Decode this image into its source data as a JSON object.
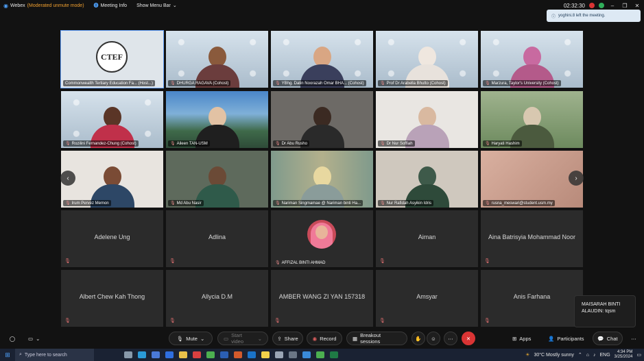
{
  "topbar": {
    "app_name": "Webex",
    "mode": "(Moderated unmute mode)",
    "meeting_info": "Meeting Info",
    "menu_bar": "Show Menu Bar",
    "timer": "02:32:30"
  },
  "toast": {
    "text": "yoghini.8 left the meeting."
  },
  "tiles": {
    "t1": {
      "label": "Commonwealth Tertiary Education Fa... (Host...)",
      "logo_text": "CTEF"
    },
    "t2": {
      "label": "DHURGA RAGAVA (Cohost)"
    },
    "t3": {
      "label": "YBhg. Datin Noorazah Omar BHA... (Cohost)"
    },
    "t4": {
      "label": "Prof Dr Arabella Bhutto (Cohost)"
    },
    "t5": {
      "label": "Marzura, Taylor's University (Cohost)"
    },
    "t6": {
      "label": "Rozilini Fernandez-Chung (Cohost)"
    },
    "t7": {
      "label": "Aileen TAN-USM"
    },
    "t8": {
      "label": "Dr Abu Rusho"
    },
    "t9": {
      "label": "Dr Nur Soffiah"
    },
    "t10": {
      "label": "Haryati Hashim"
    },
    "t11": {
      "label": "Irum Pervez Memon"
    },
    "t12": {
      "label": "Md Abu Nasir"
    },
    "t13": {
      "label": "Nariman Singmamae @ Nariman binti Ha..."
    },
    "t14": {
      "label": "Nur Rafidah Asyikin Idris"
    },
    "t15": {
      "label": "rusna_meswari@student.usm.my"
    },
    "t16": {
      "name": "Adelene Ung"
    },
    "t17": {
      "name": "Adlina"
    },
    "t18": {
      "label": "AFFIZAL BINTI AHMAD"
    },
    "t19": {
      "name": "Aiman"
    },
    "t20": {
      "name": "Aina Batrisyia Mohammad Noor"
    },
    "t21": {
      "name": "Albert Chew Kah Thong"
    },
    "t22": {
      "name": "Allycia D.M"
    },
    "t23": {
      "name": "AMBER WANG ZI YAN 157318"
    },
    "t24": {
      "name": "Amsyar"
    },
    "t25": {
      "name": "Anis Farhana"
    }
  },
  "chat_bubble": {
    "text": "MAISARAH BINTI ALAUDIN: tqsm"
  },
  "toolbar": {
    "mute": "Mute",
    "start_video": "Start video",
    "share": "Share",
    "record": "Record",
    "breakout": "Breakout sessions",
    "apps": "Apps",
    "participants": "Participants",
    "chat": "Chat"
  },
  "taskbar": {
    "search_placeholder": "Type here to search",
    "weather": "30°C  Mostly sunny",
    "lang": "ENG",
    "time": "4:34 PM",
    "date": "3/25/2024"
  },
  "colors": {
    "accent": "#6aa7ff",
    "leave": "#d93434",
    "mode": "#f0a030"
  }
}
